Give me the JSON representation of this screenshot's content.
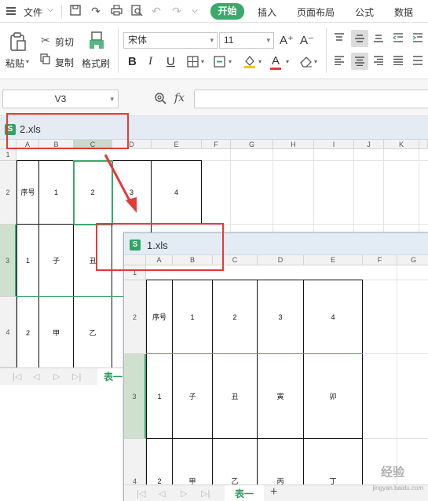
{
  "menu": {
    "file_label": "文件",
    "tabs": [
      "开始",
      "插入",
      "页面布局",
      "公式",
      "数据"
    ],
    "active_tab": "开始"
  },
  "ribbon": {
    "paste_label": "粘贴",
    "cut_label": "剪切",
    "copy_label": "复制",
    "format_painter_label": "格式刷",
    "font_name": "宋体",
    "font_size": "11",
    "bold": "B",
    "italic": "I",
    "underline": "U",
    "grow_font": "A⁺",
    "shrink_font": "A⁻",
    "font_color_letter": "A"
  },
  "formula_bar": {
    "name_box": "V3",
    "fx_label": "fx",
    "formula": ""
  },
  "window_back": {
    "title": "2.xls",
    "columns": [
      "A",
      "B",
      "C",
      "D",
      "E",
      "F",
      "G",
      "H",
      "I",
      "J",
      "K"
    ],
    "selected_column": "C",
    "rows": [
      "1",
      "2",
      "3",
      "4"
    ],
    "row2": [
      "序号",
      "1",
      "2",
      "3",
      "4"
    ],
    "row3": [
      "1",
      "子",
      "丑"
    ],
    "row4": [
      "2",
      "甲",
      "乙"
    ],
    "sheet_tab": "表一"
  },
  "window_front": {
    "title": "1.xls",
    "columns": [
      "A",
      "B",
      "C",
      "D",
      "E",
      "F",
      "G"
    ],
    "rows": [
      "1",
      "2",
      "3",
      "4"
    ],
    "row2": [
      "序号",
      "1",
      "2",
      "3",
      "4"
    ],
    "row3": [
      "1",
      "子",
      "丑",
      "寅",
      "卯"
    ],
    "row4": [
      "2",
      "甲",
      "乙",
      "丙",
      "丁"
    ],
    "sheet_tab": "表一",
    "add_sheet": "+"
  },
  "watermark": {
    "brand": "经验",
    "site": "jingyan.baidu.com"
  },
  "colors": {
    "accent": "#3aa96b",
    "annotation": "#e53935"
  }
}
